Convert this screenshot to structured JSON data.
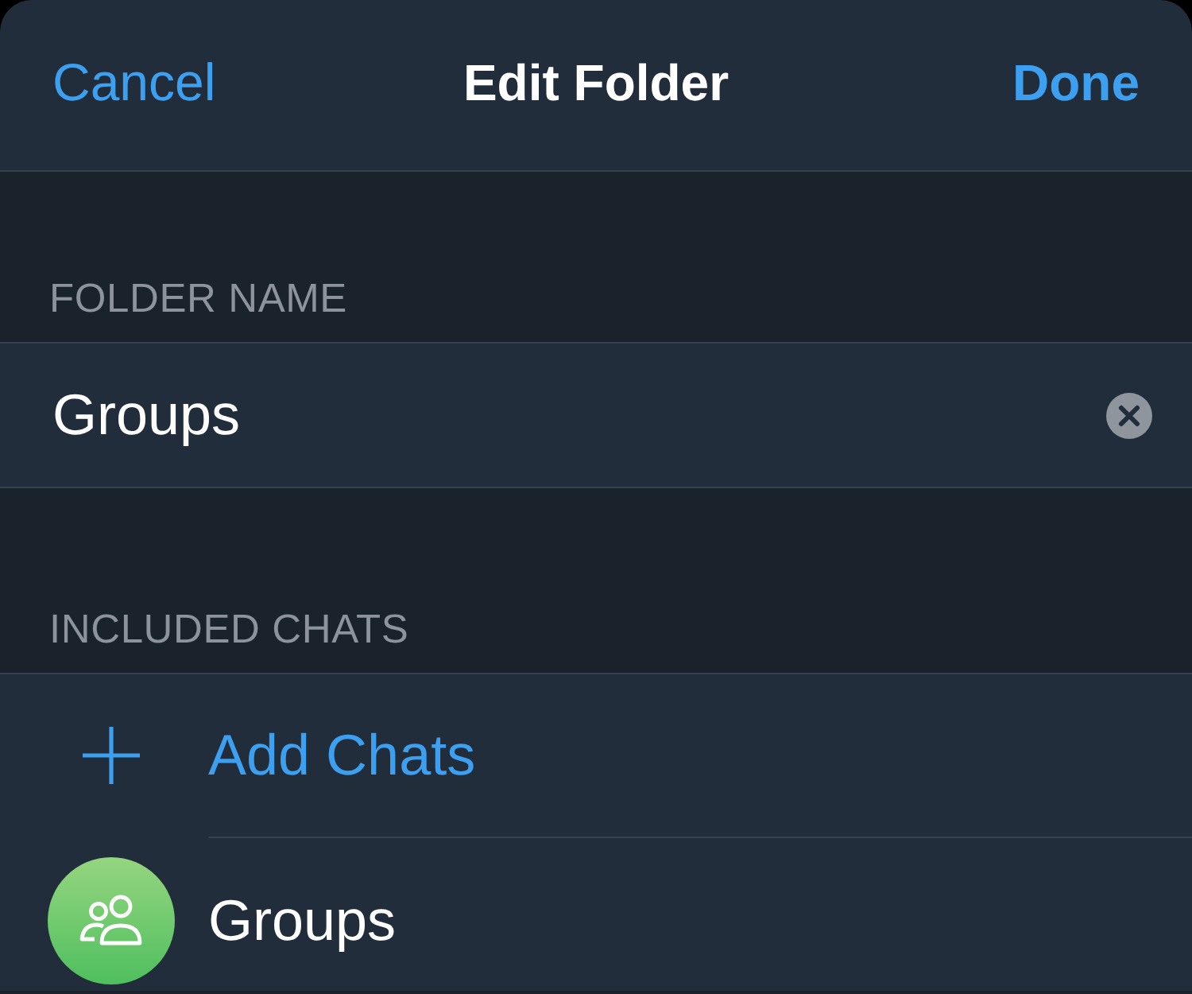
{
  "nav": {
    "cancel": "Cancel",
    "title": "Edit Folder",
    "done": "Done"
  },
  "sections": [
    {
      "kind": "name_field",
      "header": "FOLDER NAME",
      "value": "Groups"
    },
    {
      "kind": "chat_list",
      "header": "INCLUDED CHATS",
      "items": [
        {
          "kind": "add",
          "label": "Add Chats"
        },
        {
          "kind": "group",
          "label": "Groups"
        }
      ]
    }
  ]
}
